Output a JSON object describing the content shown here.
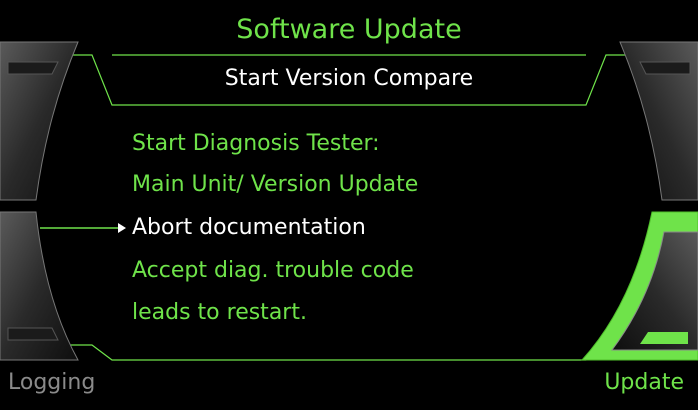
{
  "title": "Software Update",
  "header": "Start Version Compare",
  "lines": [
    {
      "text": "Start Diagnosis Tester:",
      "selected": false
    },
    {
      "text": "Main Unit/ Version Update",
      "selected": false
    },
    {
      "text": "Abort documentation",
      "selected": true
    },
    {
      "text": "Accept diag. trouble code",
      "selected": false
    },
    {
      "text": "leads to restart.",
      "selected": false
    }
  ],
  "softkeys": {
    "left": "Logging",
    "right": "Update"
  },
  "colors": {
    "accent": "#6fe34a",
    "text": "#ffffff",
    "dim": "#8a8a8a",
    "background": "#000000"
  }
}
